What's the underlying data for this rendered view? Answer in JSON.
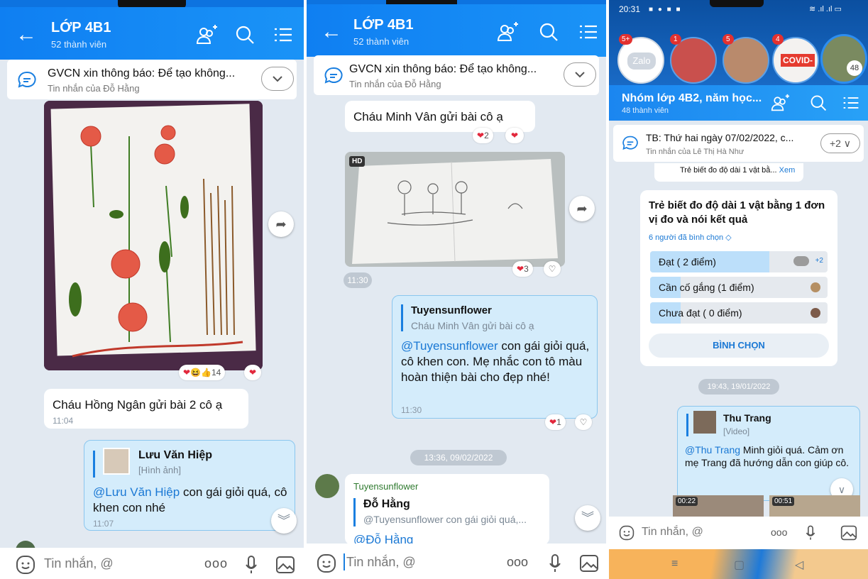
{
  "p1": {
    "title": "LỚP 4B1",
    "members": "52 thành viên",
    "pinned": {
      "text": "GVCN xin thông báo: Để tạo không...",
      "sender": "Tin nhắn của Đỗ Hằng"
    },
    "photo_reactions": "14",
    "msg1": {
      "text": "Cháu Hồng Ngân gửi bài 2 cô ạ",
      "time": "11:04"
    },
    "msg2": {
      "quote_name": "Lưu Văn Hiệp",
      "quote_type": "[Hình ảnh]",
      "mention": "@Lưu Văn Hiệp",
      "text": " con gái giỏi quá, cô khen con nhé",
      "time": "11:07"
    },
    "input_placeholder": "Tin nhắn, @"
  },
  "p2": {
    "title": "LỚP 4B1",
    "members": "52 thành viên",
    "pinned": {
      "text": "GVCN xin thông báo: Để tạo không...",
      "sender": "Tin nhắn của Đỗ Hằng"
    },
    "msg1": {
      "text": "Cháu Minh Vân gửi bài cô ạ",
      "reactions": "2"
    },
    "video": {
      "badge": "HD",
      "reactions": "3",
      "time": "11:30"
    },
    "msg2": {
      "quote_name": "Tuyensunflower",
      "quote_text": "Cháu Minh Vân gửi bài cô ạ",
      "mention": "@Tuyensunflower",
      "text": " con gái giỏi quá, cô khen con. Mẹ nhắc con tô màu hoàn thiện bài cho đẹp nhé!",
      "time": "11:30",
      "reactions": "1"
    },
    "date_divider": "13:36, 09/02/2022",
    "msg3": {
      "sender": "Tuyensunflower",
      "quote_name": "Đỗ Hằng",
      "quote_text": "@Tuyensunflower con gái giỏi quá,...",
      "mention": "@Đỗ Hằng"
    },
    "input_placeholder": "Tin nhắn, @"
  },
  "p3": {
    "status_time": "20:31",
    "stories": [
      {
        "badge": "5+",
        "label": "Zalo"
      },
      {
        "badge": "1",
        "label": ""
      },
      {
        "badge": "5",
        "label": ""
      },
      {
        "badge": "4",
        "label": "COVID-"
      },
      {
        "badge": "",
        "label": "48"
      }
    ],
    "title": "Nhóm lớp 4B2, năm học...",
    "members": "48 thành viên",
    "pinned": {
      "text": "TB: Thứ hai ngày 07/02/2022, c...",
      "sender": "Tin nhắn của Lê Thị Hà Như",
      "more": "+2"
    },
    "poll_snippet": {
      "text": "Trẻ biết đo độ dài 1 vật bằ...",
      "link": "Xem"
    },
    "poll": {
      "question": "Trẻ biết đo độ dài 1 vật bằng 1 đơn vị đo và nói kết quả",
      "voters": "6 người đã bình chọn ◇",
      "options": [
        {
          "label": "Đạt ( 2 điểm)",
          "extra": "+2",
          "share": 0.67
        },
        {
          "label": "Cần cố gắng (1 điểm)",
          "extra": "",
          "share": 0.17
        },
        {
          "label": "Chưa đạt ( 0 điểm)",
          "extra": "",
          "share": 0.17
        }
      ],
      "vote_button": "BÌNH CHỌN"
    },
    "date_divider": "19:43, 19/01/2022",
    "msg": {
      "quote_name": "Thu Trang",
      "quote_type": "[Video]",
      "mention": "@Thu Trang",
      "text": " Minh giỏi quá. Cảm ơn mẹ Trang đã hướng dẫn con giúp cô."
    },
    "videos": [
      "00:22",
      "00:51"
    ],
    "input_placeholder": "Tin nhắn, @"
  }
}
